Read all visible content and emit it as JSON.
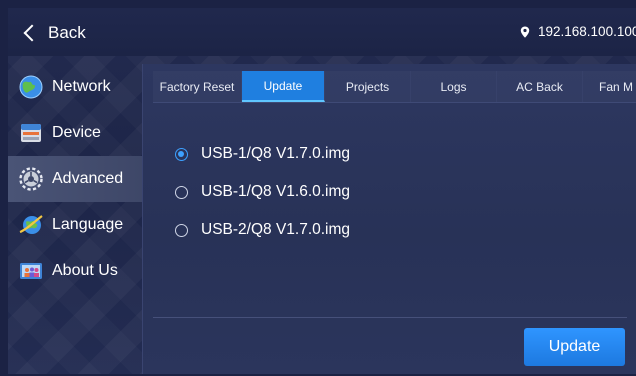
{
  "header": {
    "back_label": "Back",
    "ip_address": "192.168.100.100"
  },
  "sidebar": {
    "items": [
      {
        "label": "Network",
        "icon": "globe-network-icon",
        "active": false
      },
      {
        "label": "Device",
        "icon": "device-cabinet-icon",
        "active": false
      },
      {
        "label": "Advanced",
        "icon": "gear-icon",
        "active": true
      },
      {
        "label": "Language",
        "icon": "language-globe-icon",
        "active": false
      },
      {
        "label": "About Us",
        "icon": "about-us-icon",
        "active": false
      }
    ]
  },
  "tabs": [
    {
      "label": "Factory Reset",
      "active": false
    },
    {
      "label": "Update",
      "active": true
    },
    {
      "label": "Projects",
      "active": false
    },
    {
      "label": "Logs",
      "active": false
    },
    {
      "label": "AC Back",
      "active": false
    },
    {
      "label": "Fan M",
      "active": false
    }
  ],
  "update_options": [
    {
      "label": "USB-1/Q8 V1.7.0.img",
      "selected": true
    },
    {
      "label": "USB-1/Q8 V1.6.0.img",
      "selected": false
    },
    {
      "label": "USB-2/Q8 V1.7.0.img",
      "selected": false
    }
  ],
  "actions": {
    "update_label": "Update"
  },
  "colors": {
    "accent": "#1f7fe0",
    "radio_selected": "#3da1ff"
  }
}
